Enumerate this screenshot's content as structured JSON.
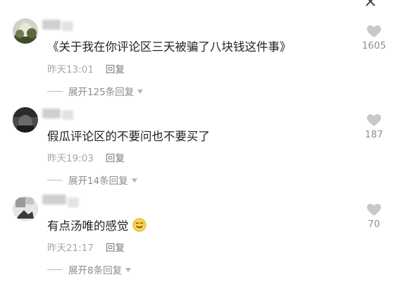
{
  "comments": [
    {
      "text": "《关于我在你评论区三天被骗了八块钱这件事》",
      "time": "昨天13:01",
      "reply_label": "回复",
      "expand_label": "展开125条回复",
      "like_count": "1605"
    },
    {
      "text": "假瓜评论区的不要问也不要买了",
      "time": "昨天19:03",
      "reply_label": "回复",
      "expand_label": "展开14条回复",
      "like_count": "187"
    },
    {
      "text": "有点汤唯的感觉",
      "time": "昨天21:17",
      "reply_label": "回复",
      "expand_label": "展开8条回复",
      "like_count": "70"
    }
  ],
  "icons": {
    "close": "close-icon",
    "like": "heart-icon",
    "expand": "chevron-down-icon",
    "emoji": "smiling-face-emoji"
  },
  "colors": {
    "text": "#222222",
    "meta": "#a7a7a7",
    "heart": "#c8c8c8"
  }
}
